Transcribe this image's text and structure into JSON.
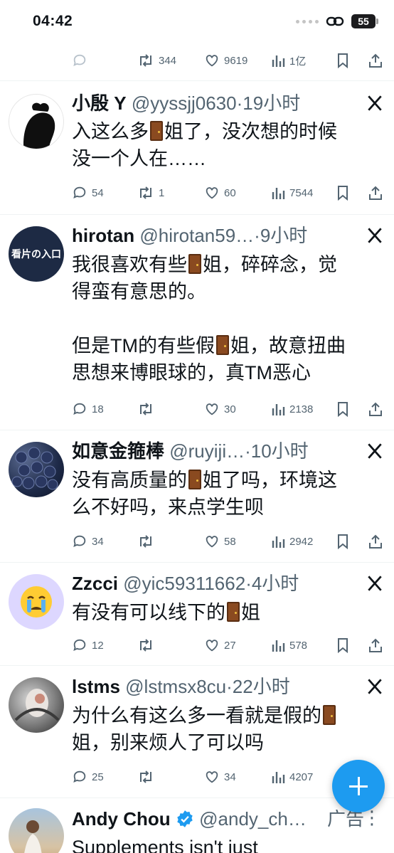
{
  "status_bar": {
    "time": "04:42",
    "battery": "55"
  },
  "top_partial": {
    "retweets": "344",
    "likes": "9619",
    "views": "1亿"
  },
  "tweets": [
    {
      "name": "小殷 Y",
      "handle": "@yyssjj0630",
      "time": "·19小时",
      "text_parts": [
        "入这么多",
        "姐了，没次想的时候\n没一个人在……"
      ],
      "replies": "54",
      "retweets": "1",
      "likes": "60",
      "views": "7544"
    },
    {
      "name": "hirotan",
      "handle": "@hirotan59…",
      "time": "·9小时",
      "avatar_text": "看片の入口",
      "text_parts": [
        "我很喜欢有些",
        "姐，碎碎念，觉\n得蛮有意思的。\n\n但是TM的有些假",
        "姐，故意扭曲\n思想来博眼球的，真TM恶心"
      ],
      "replies": "18",
      "retweets": "",
      "likes": "30",
      "views": "2138"
    },
    {
      "name": "如意金箍棒",
      "handle": "@ruyiji…",
      "time": "·10小时",
      "text_parts": [
        "没有高质量的",
        "姐了吗，环境这\n么不好吗，来点学生呗"
      ],
      "replies": "34",
      "retweets": "",
      "likes": "58",
      "views": "2942"
    },
    {
      "name": "Zzcci",
      "handle": "@yic59311662",
      "time": "·4小时",
      "text_parts": [
        "有没有可以线下的",
        "姐"
      ],
      "replies": "12",
      "retweets": "",
      "likes": "27",
      "views": "578"
    },
    {
      "name": "lstms",
      "handle": "@lstmsx8cu",
      "time": "·22小时",
      "text_parts": [
        "为什么有这么多一看就是假的",
        "\n姐，别来烦人了可以吗"
      ],
      "replies": "25",
      "retweets": "",
      "likes": "34",
      "views": "4207"
    }
  ],
  "ad": {
    "name": "Andy Chou",
    "handle": "@andy_ch…",
    "label": "广告",
    "text": "Supplements isn't just"
  }
}
